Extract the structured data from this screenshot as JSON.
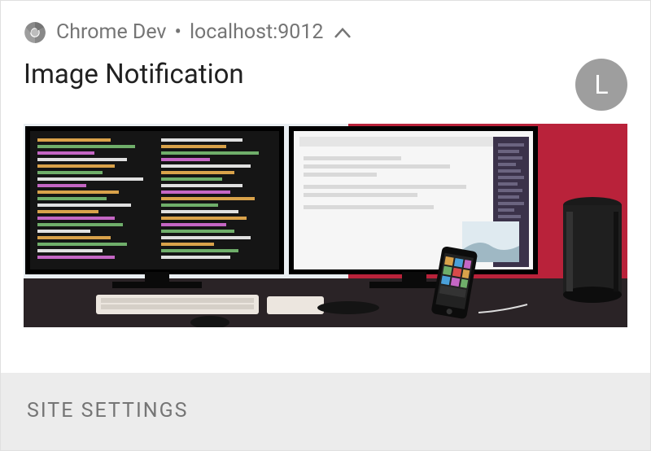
{
  "header": {
    "app_name": "Chrome Dev",
    "separator": "•",
    "origin": "localhost:9012",
    "chrome_icon": "chrome-logo",
    "collapse_icon": "^"
  },
  "notification": {
    "title": "Image Notification",
    "avatar_letter": "L"
  },
  "footer": {
    "site_settings_label": "SITE SETTINGS"
  }
}
